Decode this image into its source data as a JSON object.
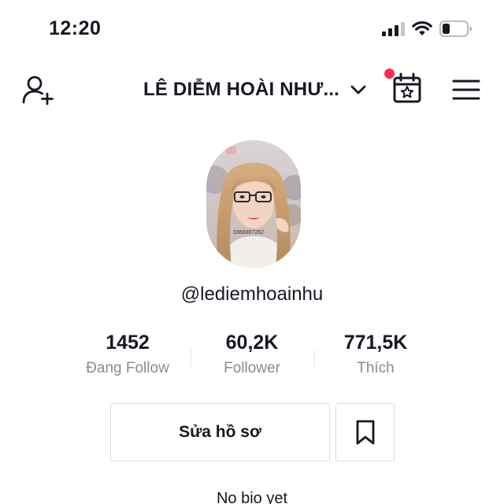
{
  "status_bar": {
    "time": "12:20",
    "icons": [
      "cellular-signal-icon",
      "wifi-icon",
      "battery-icon"
    ]
  },
  "header": {
    "account_name": "LÊ DIỄM HOÀI NHƯ...",
    "icons": [
      "add-user-icon",
      "chevron-down-icon",
      "calendar-star-icon",
      "hamburger-menu-icon"
    ],
    "notification_dot_color": "#fe2c55"
  },
  "profile": {
    "avatar_watermark": "0366607262",
    "username": "@lediemhoainhu"
  },
  "stats": [
    {
      "value": "1452",
      "label": "Đang Follow"
    },
    {
      "value": "60,2K",
      "label": "Follower"
    },
    {
      "value": "771,5K",
      "label": "Thích"
    }
  ],
  "actions": {
    "edit_profile_label": "Sửa hồ sơ",
    "bookmark_icon": "bookmark-icon"
  },
  "bio": "No bio yet"
}
